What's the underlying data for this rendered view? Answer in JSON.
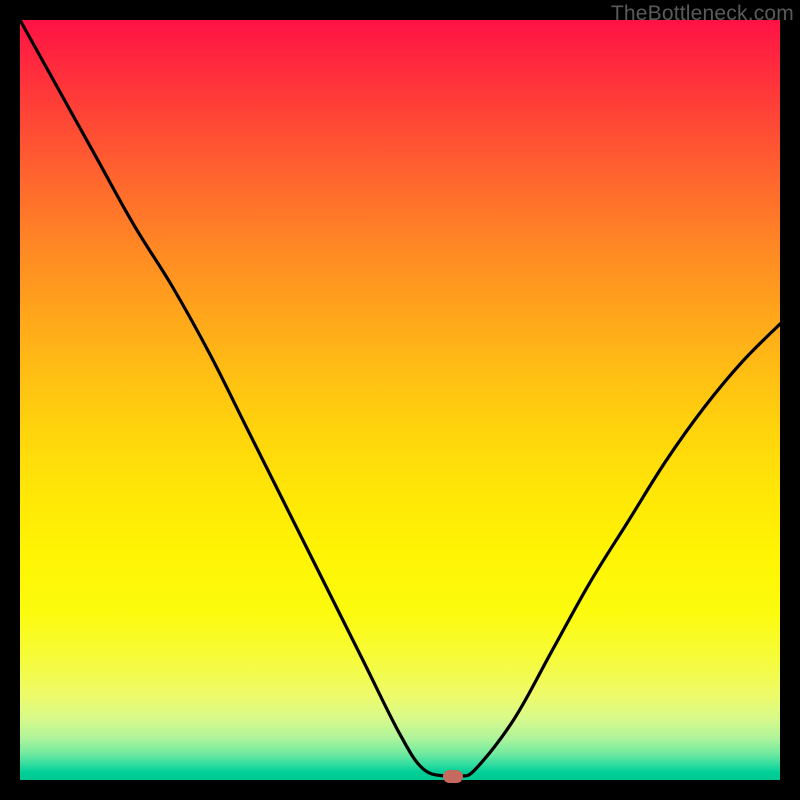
{
  "watermark": "TheBottleneck.com",
  "colors": {
    "frame": "#000000",
    "gradient_top": "#ff1245",
    "gradient_mid": "#ffe607",
    "gradient_bottom": "#00c893",
    "curve": "#000000",
    "marker": "#c46a5f"
  },
  "chart_data": {
    "type": "line",
    "title": "",
    "xlabel": "",
    "ylabel": "",
    "xlim": [
      0,
      100
    ],
    "ylim": [
      0,
      100
    ],
    "series": [
      {
        "name": "bottleneck-curve",
        "x": [
          0,
          5,
          10,
          15,
          20,
          25,
          30,
          35,
          40,
          45,
          50,
          53,
          56,
          58,
          60,
          65,
          70,
          75,
          80,
          85,
          90,
          95,
          100
        ],
        "values": [
          100,
          91,
          82,
          73,
          65,
          56,
          46,
          36,
          26,
          16,
          6,
          1.5,
          0.5,
          0.5,
          1.5,
          8,
          17,
          26,
          34,
          42,
          49,
          55,
          60
        ]
      }
    ],
    "annotations": [
      {
        "name": "optimal-marker",
        "x": 57,
        "y": 0.5
      }
    ],
    "grid": false,
    "legend": false
  }
}
